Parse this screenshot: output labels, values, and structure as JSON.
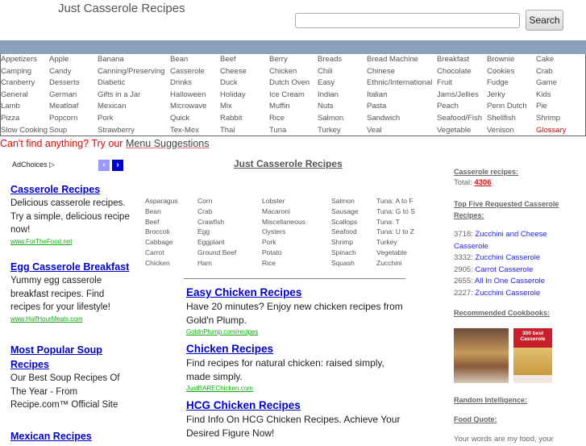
{
  "header": {
    "title": "Just Casserole Recipes",
    "search_placeholder": "",
    "search_label": "Search"
  },
  "nav": {
    "columns": [
      [
        "Appetizers",
        "Camping",
        "Cranberry",
        "General",
        "Lamb",
        "Pizza",
        "Slow Cooking"
      ],
      [
        "Apple",
        "Candy",
        "Desserts",
        "German",
        "Meatloaf",
        "Popcorn",
        "Soup"
      ],
      [
        "Banana",
        "Canning/Preserving",
        "Diabetic",
        "Gifts in a Jar",
        "Mexican",
        "Pork",
        "Strawberry"
      ],
      [
        "Bean",
        "Casserole",
        "Drinks",
        "Halloween",
        "Microwave",
        "Quick",
        "Tex-Mex"
      ],
      [
        "Beef",
        "Cheese",
        "Duck",
        "Holiday",
        "Mix",
        "Rabbit",
        "Thai"
      ],
      [
        "Berry",
        "Chicken",
        "Dutch Oven",
        "Ice Cream",
        "Muffin",
        "Rice",
        "Tuna"
      ],
      [
        "Breads",
        "Chili",
        "Easy",
        "Indian",
        "Nuts",
        "Salmon",
        "Turkey"
      ],
      [
        "Bread Machine",
        "Chinese",
        "Ethnic/International",
        "Italian",
        "Pasta",
        "Sandwich",
        "Veal"
      ],
      [
        "Breakfast",
        "Chocolate",
        "Fruit",
        "Jams/Jellies",
        "Peach",
        "Seafood/Fish",
        "Vegetable"
      ],
      [
        "Brownie",
        "Cookies",
        "Fudge",
        "Jerky",
        "Penn Dutch",
        "Shellfish",
        "Venison"
      ],
      [
        "Cake",
        "Crab",
        "Game",
        "Kids",
        "Pie",
        "Shrimp",
        "Glossary"
      ]
    ],
    "highlight_color": "#e00000",
    "bar_color": "#8aa0bb"
  },
  "cant_find": {
    "text": "Can't find anything? Try our ",
    "link": "Menu Suggestions"
  },
  "left_ads": {
    "adchoices": "AdChoices ▷",
    "ads": [
      {
        "title": "Casserole Recipes",
        "text": "Delicious casserole recipes. Try a simple, delicious recipe now!",
        "url": "www.ForTheFood.net"
      },
      {
        "title": "Egg Casserole Breakfast",
        "text": "Yummy egg casserole breakfast recipes. Find recipes for your lifestyle!",
        "url": "www.HalfHourMeals.com"
      },
      {
        "title": "Most Popular Soup Recipes",
        "text": "Our Best Soup Recipes Of The Year - From Recipe.com™ Official Site",
        "url": ""
      },
      {
        "title": "Mexican Recipes",
        "text": "",
        "url": ""
      }
    ]
  },
  "center": {
    "title": "Just Casserole Recipes",
    "categories": [
      [
        "Asparagus",
        "Bean",
        "Beef",
        "Broccoli",
        "Cabbage",
        "Carrot",
        "Chicken"
      ],
      [
        "Corn",
        "Crab",
        "Crawfish",
        "Egg",
        "Eggplant",
        "Ground Beef",
        "Ham"
      ],
      [
        "Lobster",
        "Macaroni",
        "Miscellaneous",
        "Oysters",
        "Pork",
        "Potato",
        "Rice"
      ],
      [
        "Salmon",
        "Sausage",
        "Scallops",
        "Seafood",
        "Shrimp",
        "Spinach",
        "Squash"
      ],
      [
        "Tuna: A to F",
        "Tuna: G to S",
        "Tuna: T",
        "Tuna: U to Z",
        "Turkey",
        "Vegetable",
        "Zucchini"
      ]
    ],
    "ads": [
      {
        "title": "Easy Chicken Recipes",
        "text": "Have 20 minutes? Enjoy new chicken recipes from Gold'n Plump.",
        "url": "GoldnPlump.com/recipes"
      },
      {
        "title": "Chicken Recipes",
        "text": "Find recipes for natural chicken: raised simply, made simply.",
        "url": "JustBAREChicken.com"
      },
      {
        "title": "HCG Chicken Recipes",
        "text": "Find Info On HCG Chicken Recipes. Achieve Your Desired Figure Now!",
        "url": ""
      }
    ]
  },
  "sidebar": {
    "casserole_heading": "Casserole recipes:",
    "total_label": "Total: ",
    "total": "4306",
    "top_heading": "Top Five Requested Casserole Recipes:",
    "top": [
      {
        "count": "3718: ",
        "name": "Zucchini and Cheese Casserole"
      },
      {
        "count": "3332: ",
        "name": "Zucchini Casserole"
      },
      {
        "count": "2905: ",
        "name": "Carrot Casserole"
      },
      {
        "count": "2655: ",
        "name": "All In One Casserole"
      },
      {
        "count": "2227: ",
        "name": "Zucchini Casserole"
      }
    ],
    "cookbooks_heading": "Recommended Cookbooks:",
    "book2_cover": "300 best Casserole",
    "random_heading": "Random Intelligence:",
    "quote_heading": "Food Quote:",
    "quote": "Your words are my food, your"
  }
}
